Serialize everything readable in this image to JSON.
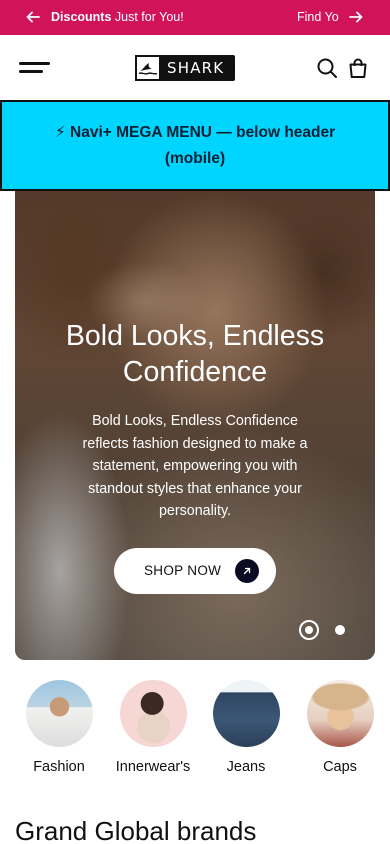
{
  "announcement": {
    "bold": "Discounts",
    "text": " Just for You!",
    "next_text": "Find Yo",
    "left_arrow_icon": "arrow-left-icon",
    "right_arrow_icon": "arrow-right-icon",
    "background": "#d1145a"
  },
  "header": {
    "menu_icon": "hamburger-menu-icon",
    "logo_text": "SHARK",
    "search_icon": "search-icon",
    "bag_icon": "shopping-bag-icon"
  },
  "mega_menu": {
    "label": "⚡ Navi+ MEGA MENU — below header (mobile)",
    "background": "#00d5ff"
  },
  "hero": {
    "title": "Bold Looks, Endless Confidence",
    "description": "Bold Looks, Endless Confidence reflects fashion designed to make a statement, empowering you with standout styles that enhance your personality.",
    "cta_label": "SHOP NOW",
    "cta_icon": "arrow-up-right-icon",
    "slides_total": 2,
    "active_slide": 1
  },
  "categories": [
    {
      "label": "Fashion"
    },
    {
      "label": "Innerwear's"
    },
    {
      "label": "Jeans"
    },
    {
      "label": "Caps"
    }
  ],
  "brands_section": {
    "title": "Grand Global brands"
  }
}
